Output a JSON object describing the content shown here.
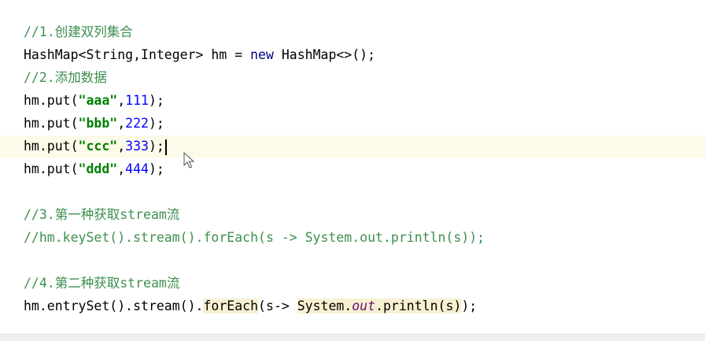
{
  "editor": {
    "lines": [
      {
        "segments": [
          {
            "text": "//1.",
            "cls": "comment"
          },
          {
            "text": "创建双列集合",
            "cls": "comment-cn"
          }
        ]
      },
      {
        "segments": [
          {
            "text": "HashMap<String,Integer> hm = ",
            "cls": ""
          },
          {
            "text": "new",
            "cls": "kw"
          },
          {
            "text": " HashMap<>();",
            "cls": ""
          }
        ]
      },
      {
        "segments": [
          {
            "text": "//2.",
            "cls": "comment"
          },
          {
            "text": "添加数据",
            "cls": "comment-cn"
          }
        ]
      },
      {
        "segments": [
          {
            "text": "hm.put(",
            "cls": ""
          },
          {
            "text": "\"aaa\"",
            "cls": "str"
          },
          {
            "text": ",",
            "cls": ""
          },
          {
            "text": "111",
            "cls": "num"
          },
          {
            "text": ");",
            "cls": ""
          }
        ]
      },
      {
        "segments": [
          {
            "text": "hm.put(",
            "cls": ""
          },
          {
            "text": "\"bbb\"",
            "cls": "str"
          },
          {
            "text": ",",
            "cls": ""
          },
          {
            "text": "222",
            "cls": "num"
          },
          {
            "text": ");",
            "cls": ""
          }
        ]
      },
      {
        "current": true,
        "caret": true,
        "segments": [
          {
            "text": "hm.put(",
            "cls": ""
          },
          {
            "text": "\"ccc\"",
            "cls": "str"
          },
          {
            "text": ",",
            "cls": ""
          },
          {
            "text": "333",
            "cls": "num"
          },
          {
            "text": ");",
            "cls": ""
          }
        ]
      },
      {
        "segments": [
          {
            "text": "hm.put(",
            "cls": ""
          },
          {
            "text": "\"ddd\"",
            "cls": "str"
          },
          {
            "text": ",",
            "cls": ""
          },
          {
            "text": "444",
            "cls": "num"
          },
          {
            "text": ");",
            "cls": ""
          }
        ]
      },
      {
        "segments": []
      },
      {
        "segments": [
          {
            "text": "//3.",
            "cls": "comment"
          },
          {
            "text": "第一种获取",
            "cls": "comment-cn"
          },
          {
            "text": "stream",
            "cls": "comment"
          },
          {
            "text": "流",
            "cls": "comment-cn"
          }
        ]
      },
      {
        "segments": [
          {
            "text": "//hm.keySet().stream().forEach(s -> System.out.println(s));",
            "cls": "comment"
          }
        ]
      },
      {
        "segments": []
      },
      {
        "segments": [
          {
            "text": "//4.",
            "cls": "comment"
          },
          {
            "text": "第二种获取",
            "cls": "comment-cn"
          },
          {
            "text": "stream",
            "cls": "comment"
          },
          {
            "text": "流",
            "cls": "comment-cn"
          }
        ]
      },
      {
        "segments": [
          {
            "text": "hm.entrySet().stream().",
            "cls": ""
          },
          {
            "text": "forEach",
            "cls": "hl"
          },
          {
            "text": "(s-> ",
            "cls": ""
          },
          {
            "text": "System.",
            "cls": "hl"
          },
          {
            "text": "out",
            "cls": "field hl"
          },
          {
            "text": ".println(s)",
            "cls": "hl"
          },
          {
            "text": ");",
            "cls": ""
          }
        ]
      }
    ]
  }
}
